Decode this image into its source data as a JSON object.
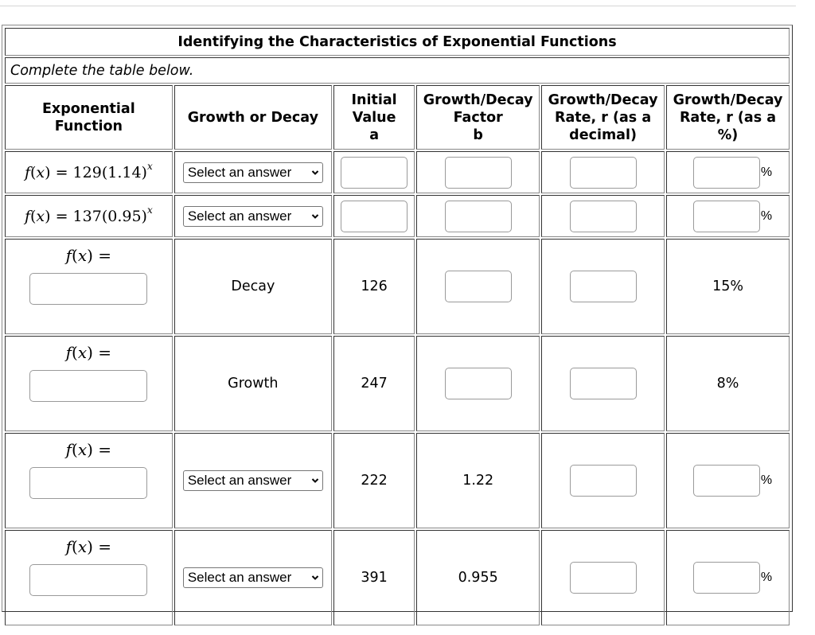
{
  "title": "Identifying the Characteristics of Exponential Functions",
  "instruction": "Complete the table below.",
  "headers": [
    "Exponential Function",
    "Growth or Decay",
    "Initial Value a",
    "Growth/Decay Factor b",
    "Growth/Decay Rate, r (as a decimal)",
    "Growth/Decay Rate, r (as a %)"
  ],
  "header_lines": [
    [
      "Exponential",
      "Function"
    ],
    [
      "Growth or Decay"
    ],
    [
      "Initial",
      "Value",
      "a"
    ],
    [
      "Growth/Decay",
      "Factor",
      "b"
    ],
    [
      "Growth/Decay",
      "Rate, r (as a",
      "decimal)"
    ],
    [
      "Growth/Decay",
      "Rate, r (as a",
      "%)"
    ]
  ],
  "select_placeholder": "Select an answer",
  "percent_sign": "%",
  "fx_label": "f(x) =",
  "rows": [
    {
      "function": {
        "prefix": "f(x) = ",
        "a": "129",
        "b": "(1.14)",
        "exp": "x"
      },
      "growth_decay": null,
      "initial_value": null,
      "factor": null,
      "rate_decimal": null,
      "rate_percent": null
    },
    {
      "function": {
        "prefix": "f(x) = ",
        "a": "137",
        "b": "(0.95)",
        "exp": "x"
      },
      "growth_decay": null,
      "initial_value": null,
      "factor": null,
      "rate_decimal": null,
      "rate_percent": null
    },
    {
      "function": null,
      "growth_decay": "Decay",
      "initial_value": "126",
      "factor": null,
      "rate_decimal": null,
      "rate_percent": "15%"
    },
    {
      "function": null,
      "growth_decay": "Growth",
      "initial_value": "247",
      "factor": null,
      "rate_decimal": null,
      "rate_percent": "8%"
    },
    {
      "function": null,
      "growth_decay": null,
      "initial_value": "222",
      "factor": "1.22",
      "rate_decimal": null,
      "rate_percent": null
    },
    {
      "function": null,
      "growth_decay": null,
      "initial_value": "391",
      "factor": "0.955",
      "rate_decimal": null,
      "rate_percent": null
    }
  ]
}
